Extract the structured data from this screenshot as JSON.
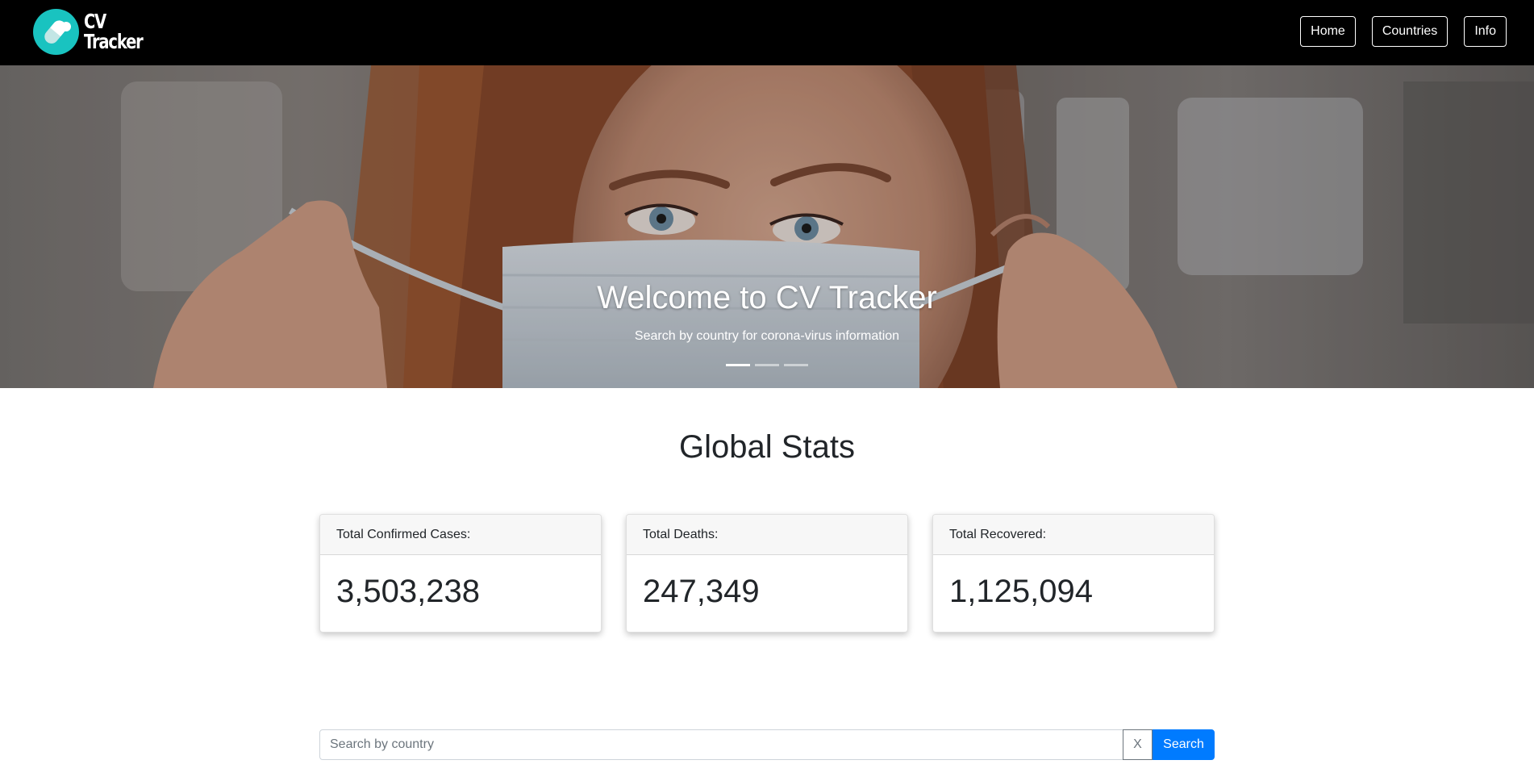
{
  "navbar": {
    "brand_line1": "CV",
    "brand_line2": "Tracker",
    "links": [
      {
        "label": "Home"
      },
      {
        "label": "Countries"
      },
      {
        "label": "Info"
      }
    ]
  },
  "carousel": {
    "title": "Welcome to CV Tracker",
    "subtitle": "Search by country for corona-virus information",
    "slide_count": 3,
    "active_slide": 1
  },
  "stats": {
    "title": "Global Stats",
    "cards": [
      {
        "label": "Total Confirmed Cases:",
        "value": "3,503,238"
      },
      {
        "label": "Total Deaths:",
        "value": "247,349"
      },
      {
        "label": "Total Recovered:",
        "value": "1,125,094"
      }
    ]
  },
  "search": {
    "placeholder": "Search by country",
    "value": "",
    "clear_label": "X",
    "button_label": "Search"
  },
  "colors": {
    "navbar_bg": "#000000",
    "logo_accent": "#19c3c0",
    "primary_button": "#007bff"
  }
}
